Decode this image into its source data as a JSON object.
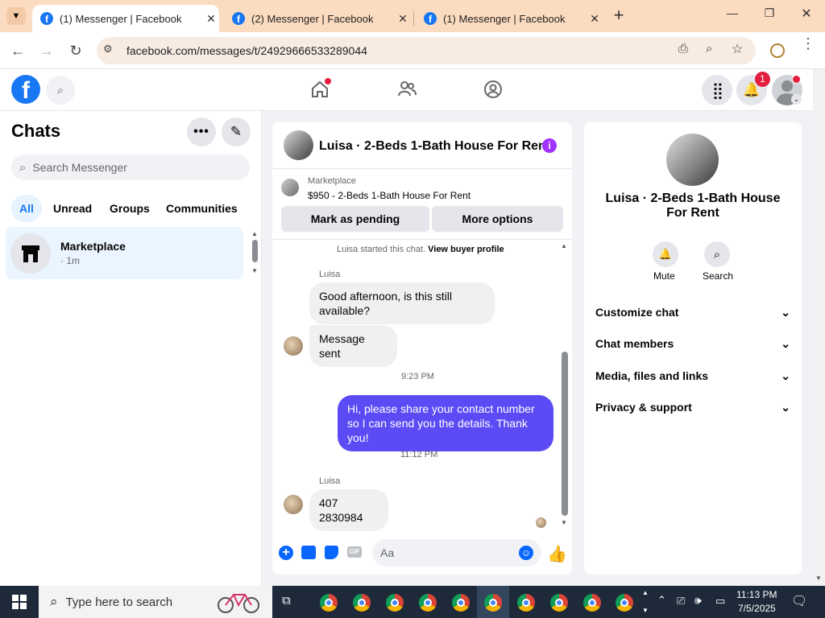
{
  "browser": {
    "tabs": [
      {
        "title": "(1) Messenger | Facebook",
        "active": true
      },
      {
        "title": "(2) Messenger | Facebook",
        "active": false
      },
      {
        "title": "(1) Messenger | Facebook",
        "active": false
      }
    ],
    "url": "facebook.com/messages/t/24929666533289044"
  },
  "fb_header": {
    "logo": "f",
    "notifications_count": "1"
  },
  "sidebar": {
    "title": "Chats",
    "search_placeholder": "Search Messenger",
    "filters": [
      "All",
      "Unread",
      "Groups",
      "Communities"
    ],
    "active_filter": "All",
    "conversations": [
      {
        "name": "Marketplace",
        "meta": "· 1m"
      }
    ]
  },
  "chat": {
    "title": "Luisa · 2-Beds 1-Bath House For Rent",
    "listing_source": "Marketplace",
    "listing_detail": "$950 - 2-Beds 1-Bath House For Rent",
    "mark_pending_label": "Mark as pending",
    "more_options_label": "More options",
    "started_text": "Luisa started this chat.",
    "buyer_profile_link": "View buyer profile",
    "messages": [
      {
        "sender": "Luisa",
        "text": "Good afternoon, is this still available?"
      },
      {
        "sender": "",
        "text": "Message sent"
      },
      {
        "timestamp": "9:23 PM"
      },
      {
        "sender": "me",
        "text": "Hi, please share your contact number so I can send you the details. Thank you!"
      },
      {
        "timestamp": "11:12 PM"
      },
      {
        "sender": "Luisa",
        "text": "407 2830984"
      }
    ],
    "composer_placeholder": "Aa"
  },
  "info": {
    "title": "Luisa · 2-Beds 1-Bath House For Rent",
    "actions": [
      {
        "label": "Mute",
        "icon": "bell-icon"
      },
      {
        "label": "Search",
        "icon": "search-icon"
      }
    ],
    "sections": [
      "Customize chat",
      "Chat members",
      "Media, files and links",
      "Privacy & support"
    ]
  },
  "taskbar": {
    "search_placeholder": "Type here to search",
    "time": "11:13 PM",
    "date": "7/5/2025"
  },
  "colors": {
    "fb_blue": "#1877f2",
    "messenger_purple": "#5b4bf5",
    "tab_strip": "#fcdcc0"
  }
}
